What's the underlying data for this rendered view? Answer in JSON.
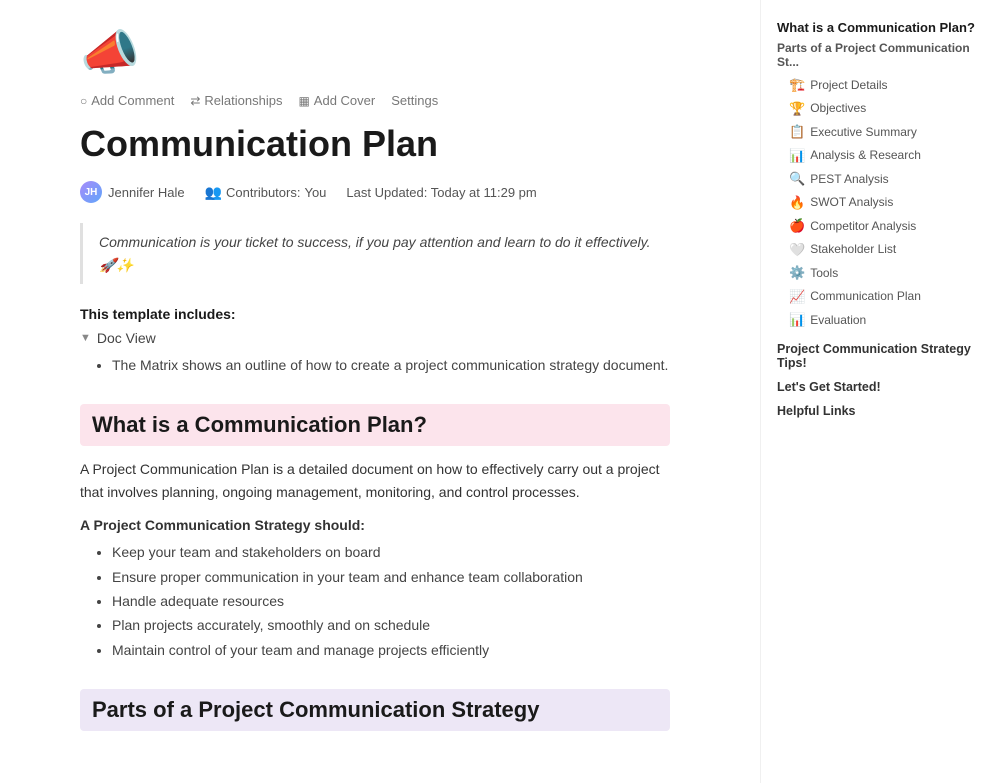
{
  "doc": {
    "icon": "📣",
    "title": "Communication Plan",
    "toolbar": [
      {
        "id": "add-comment",
        "icon": "💬",
        "label": "Add Comment"
      },
      {
        "id": "relationships",
        "icon": "🔗",
        "label": "Relationships"
      },
      {
        "id": "add-cover",
        "icon": "🖼",
        "label": "Add Cover"
      },
      {
        "id": "settings",
        "icon": "",
        "label": "Settings"
      }
    ],
    "author": {
      "name": "Jennifer Hale",
      "avatar_text": "JH"
    },
    "contributors_label": "Contributors:",
    "contributors_value": "You",
    "last_updated_label": "Last Updated:",
    "last_updated_value": "Today at 11:29 pm",
    "quote": "Communication is your ticket to success, if you pay attention and learn to do it effectively. 🚀✨",
    "template_includes_label": "This template includes:",
    "doc_view_label": "Doc View",
    "doc_view_description": "The Matrix shows an outline of how to create a project communication strategy document.",
    "sections": [
      {
        "id": "what-is",
        "heading": "What is a Communication Plan?",
        "heading_style": "pink",
        "paragraphs": [
          "A Project Communication Plan is a detailed document on how to effectively carry out a project that involves planning, ongoing management, monitoring, and control processes.",
          "A Project Communication Strategy should:"
        ],
        "bullets": [
          "Keep your team and stakeholders on board",
          "Ensure proper communication in your team and enhance team collaboration",
          "Handle adequate resources",
          "Plan projects accurately, smoothly and on schedule",
          "Maintain control of your team and manage projects efficiently"
        ]
      },
      {
        "id": "parts-of",
        "heading": "Parts of a Project Communication Strategy",
        "heading_style": "lavender"
      }
    ]
  },
  "sidebar": {
    "main_heading": "What is a Communication Plan?",
    "sub_heading": "Parts of a Project Communication St...",
    "items": [
      {
        "icon": "🏗️",
        "label": "Project Details"
      },
      {
        "icon": "🏆",
        "label": "Objectives"
      },
      {
        "icon": "📋",
        "label": "Executive Summary"
      },
      {
        "icon": "📊",
        "label": "Analysis & Research"
      },
      {
        "icon": "🔍",
        "label": "PEST Analysis"
      },
      {
        "icon": "🔥",
        "label": "SWOT Analysis"
      },
      {
        "icon": "🍎",
        "label": "Competitor Analysis"
      },
      {
        "icon": "🤍",
        "label": "Stakeholder List"
      },
      {
        "icon": "⚙️",
        "label": "Tools"
      },
      {
        "icon": "📈",
        "label": "Communication Plan"
      },
      {
        "icon": "📊",
        "label": "Evaluation"
      }
    ],
    "section_links": [
      "Project Communication Strategy Tips!",
      "Let's Get Started!",
      "Helpful Links"
    ]
  }
}
